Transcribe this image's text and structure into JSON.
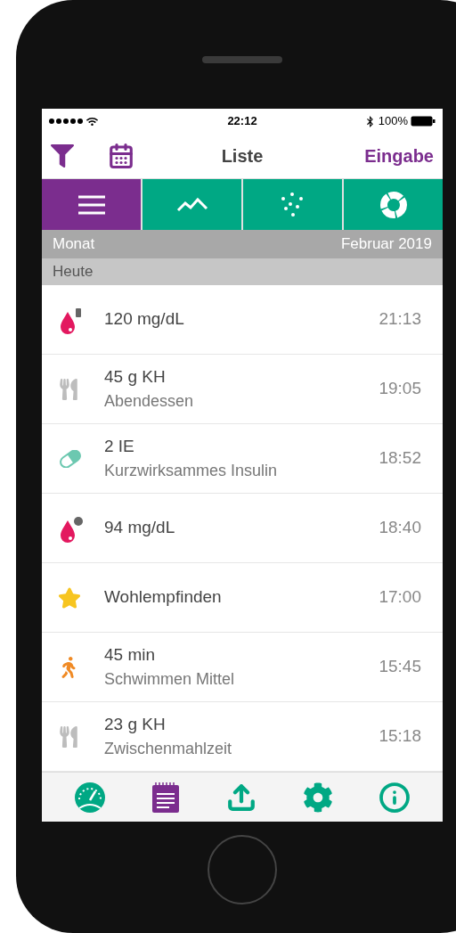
{
  "status_bar": {
    "time": "22:12",
    "battery": "100%"
  },
  "nav": {
    "title": "Liste",
    "action": "Eingabe"
  },
  "view_tabs": [
    {
      "kind": "list",
      "selected": true
    },
    {
      "kind": "line",
      "selected": false
    },
    {
      "kind": "scatter",
      "selected": false
    },
    {
      "kind": "donut",
      "selected": false
    }
  ],
  "month_bar": {
    "label": "Monat",
    "value": "Februar 2019"
  },
  "section": "Heute",
  "entries": [
    {
      "kind": "glucose_after",
      "title": "120 mg/dL",
      "time": "21:13"
    },
    {
      "kind": "meal",
      "title": "45 g KH",
      "subtitle": "Abendessen",
      "time": "19:05"
    },
    {
      "kind": "insulin",
      "title": "2 IE",
      "subtitle": "Kurzwirksammes Insulin",
      "time": "18:52"
    },
    {
      "kind": "glucose_before",
      "title": "94 mg/dL",
      "time": "18:40"
    },
    {
      "kind": "mood",
      "title": "Wohlempfinden",
      "time": "17:00"
    },
    {
      "kind": "activity",
      "title": "45 min",
      "subtitle": "Schwimmen Mittel",
      "time": "15:45"
    },
    {
      "kind": "meal",
      "title": "23 g KH",
      "subtitle": "Zwischenmahlzeit",
      "time": "15:18"
    }
  ],
  "bottom_tabs": [
    {
      "kind": "dashboard"
    },
    {
      "kind": "diary"
    },
    {
      "kind": "export"
    },
    {
      "kind": "settings"
    },
    {
      "kind": "info"
    }
  ]
}
